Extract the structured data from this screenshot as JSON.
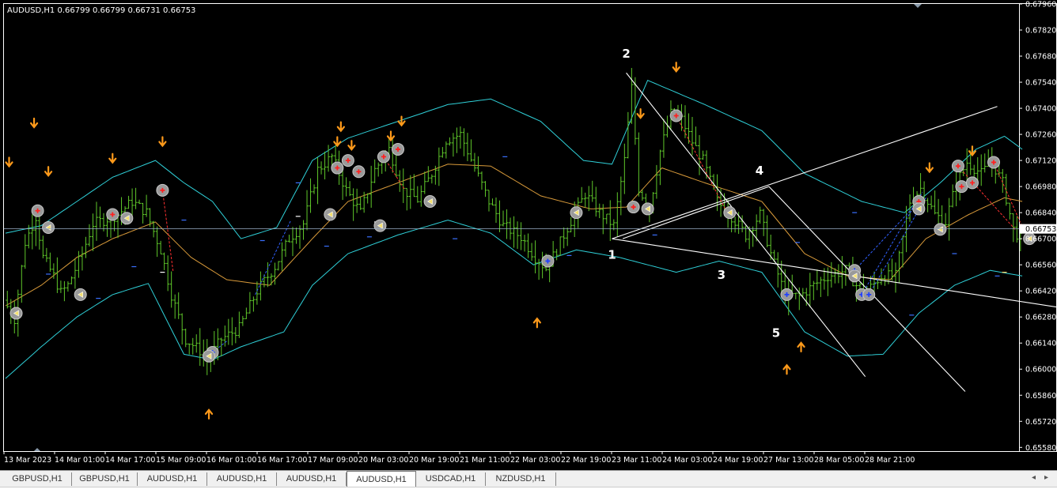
{
  "symbol_header": "AUDUSD,H1  0.66799 0.66799 0.66731 0.66753",
  "current_price_label": "0.66753",
  "colors": {
    "background": "#000000",
    "frame": "#ffffff",
    "bull_bar": "#5fc72a",
    "upper_lower_band": "#2fd0d8",
    "middle_band": "#d89a3a",
    "pattern_lines": "#ffffff",
    "arrow": "#ff9a1a",
    "projection_red": "#ff3030",
    "projection_blue": "#3060ff",
    "current_price_line": "#9ab0c8"
  },
  "wave_labels": [
    "1",
    "2",
    "3",
    "4",
    "5"
  ],
  "tabs": [
    "GBPUSD,H1",
    "GBPUSD,H1",
    "AUDUSD,H1",
    "AUDUSD,H1",
    "AUDUSD,H1",
    "AUDUSD,H1",
    "USDCAD,H1",
    "NZDUSD,H1"
  ],
  "active_tab": 5,
  "tab_scroll_left": "◂",
  "tab_scroll_right": "▸",
  "chart_data": {
    "type": "candlestick",
    "title": "AUDUSD,H1",
    "ylim": [
      0.6556,
      0.6796
    ],
    "y_ticks": [
      "0.67960",
      "0.67820",
      "0.67680",
      "0.67540",
      "0.67400",
      "0.67260",
      "0.67120",
      "0.66980",
      "0.66840",
      "0.66700",
      "0.66560",
      "0.66420",
      "0.66280",
      "0.66140",
      "0.66000",
      "0.65860",
      "0.65720",
      "0.65580"
    ],
    "x_ticks": [
      "13 Mar 2023",
      "14 Mar 01:00",
      "14 Mar 17:00",
      "15 Mar 09:00",
      "16 Mar 01:00",
      "16 Mar 17:00",
      "17 Mar 09:00",
      "20 Mar 03:00",
      "20 Mar 19:00",
      "21 Mar 11:00",
      "22 Mar 03:00",
      "22 Mar 19:00",
      "23 Mar 11:00",
      "24 Mar 03:00",
      "24 Mar 19:00",
      "27 Mar 13:00",
      "28 Mar 05:00",
      "28 Mar 21:00"
    ],
    "bars_count": 285,
    "current_price": 0.66753,
    "price_path": [
      [
        0,
        0.6637
      ],
      [
        3,
        0.6627
      ],
      [
        6,
        0.6668
      ],
      [
        9,
        0.6682
      ],
      [
        11,
        0.666
      ],
      [
        14,
        0.665
      ],
      [
        16,
        0.6641
      ],
      [
        18,
        0.6645
      ],
      [
        22,
        0.6662
      ],
      [
        25,
        0.6678
      ],
      [
        28,
        0.668
      ],
      [
        32,
        0.6683
      ],
      [
        36,
        0.669
      ],
      [
        40,
        0.6684
      ],
      [
        44,
        0.6664
      ],
      [
        47,
        0.664
      ],
      [
        51,
        0.6616
      ],
      [
        55,
        0.661
      ],
      [
        57,
        0.6605
      ],
      [
        61,
        0.6616
      ],
      [
        66,
        0.6622
      ],
      [
        71,
        0.6642
      ],
      [
        76,
        0.6655
      ],
      [
        80,
        0.667
      ],
      [
        84,
        0.6678
      ],
      [
        88,
        0.6707
      ],
      [
        92,
        0.6714
      ],
      [
        96,
        0.6696
      ],
      [
        100,
        0.6684
      ],
      [
        104,
        0.6707
      ],
      [
        108,
        0.6718
      ],
      [
        112,
        0.6696
      ],
      [
        116,
        0.6691
      ],
      [
        120,
        0.6705
      ],
      [
        124,
        0.6723
      ],
      [
        128,
        0.6726
      ],
      [
        132,
        0.6708
      ],
      [
        136,
        0.669
      ],
      [
        140,
        0.6677
      ],
      [
        145,
        0.6671
      ],
      [
        149,
        0.666
      ],
      [
        152,
        0.6654
      ],
      [
        155,
        0.6664
      ],
      [
        158,
        0.6676
      ],
      [
        163,
        0.6694
      ],
      [
        167,
        0.6684
      ],
      [
        171,
        0.6677
      ],
      [
        174,
        0.6712
      ],
      [
        176,
        0.6751
      ],
      [
        178,
        0.6697
      ],
      [
        181,
        0.6686
      ],
      [
        184,
        0.6717
      ],
      [
        187,
        0.6737
      ],
      [
        190,
        0.6734
      ],
      [
        193,
        0.6722
      ],
      [
        196,
        0.6712
      ],
      [
        200,
        0.669
      ],
      [
        204,
        0.6682
      ],
      [
        208,
        0.6672
      ],
      [
        212,
        0.6683
      ],
      [
        215,
        0.6662
      ],
      [
        219,
        0.664
      ],
      [
        223,
        0.6639
      ],
      [
        227,
        0.6645
      ],
      [
        231,
        0.665
      ],
      [
        236,
        0.6653
      ],
      [
        239,
        0.6645
      ],
      [
        242,
        0.6642
      ],
      [
        246,
        0.665
      ],
      [
        250,
        0.665
      ],
      [
        254,
        0.669
      ],
      [
        257,
        0.6697
      ],
      [
        261,
        0.6683
      ],
      [
        264,
        0.6679
      ],
      [
        267,
        0.67
      ],
      [
        270,
        0.6711
      ],
      [
        274,
        0.6705
      ],
      [
        277,
        0.6711
      ],
      [
        280,
        0.67
      ],
      [
        283,
        0.6675
      ],
      [
        285,
        0.667
      ]
    ],
    "upper_band": [
      [
        0,
        0.6673
      ],
      [
        10,
        0.6677
      ],
      [
        20,
        0.669
      ],
      [
        30,
        0.6703
      ],
      [
        42,
        0.6712
      ],
      [
        50,
        0.67
      ],
      [
        58,
        0.669
      ],
      [
        66,
        0.667
      ],
      [
        76,
        0.6676
      ],
      [
        86,
        0.6712
      ],
      [
        96,
        0.6724
      ],
      [
        110,
        0.6733
      ],
      [
        124,
        0.6742
      ],
      [
        136,
        0.6745
      ],
      [
        150,
        0.6733
      ],
      [
        162,
        0.6712
      ],
      [
        170,
        0.671
      ],
      [
        180,
        0.6755
      ],
      [
        196,
        0.6742
      ],
      [
        212,
        0.6728
      ],
      [
        224,
        0.6705
      ],
      [
        240,
        0.669
      ],
      [
        252,
        0.6684
      ],
      [
        262,
        0.67
      ],
      [
        272,
        0.6718
      ],
      [
        280,
        0.6725
      ],
      [
        285,
        0.6718
      ]
    ],
    "lower_band": [
      [
        0,
        0.6595
      ],
      [
        10,
        0.6612
      ],
      [
        20,
        0.6628
      ],
      [
        30,
        0.664
      ],
      [
        40,
        0.6646
      ],
      [
        50,
        0.6608
      ],
      [
        58,
        0.6605
      ],
      [
        66,
        0.6612
      ],
      [
        78,
        0.662
      ],
      [
        86,
        0.6645
      ],
      [
        96,
        0.6662
      ],
      [
        110,
        0.6672
      ],
      [
        124,
        0.668
      ],
      [
        136,
        0.6673
      ],
      [
        148,
        0.6656
      ],
      [
        160,
        0.6664
      ],
      [
        172,
        0.666
      ],
      [
        188,
        0.6652
      ],
      [
        200,
        0.6658
      ],
      [
        212,
        0.6652
      ],
      [
        224,
        0.662
      ],
      [
        236,
        0.6607
      ],
      [
        246,
        0.6608
      ],
      [
        256,
        0.663
      ],
      [
        266,
        0.6645
      ],
      [
        276,
        0.6653
      ],
      [
        285,
        0.665
      ]
    ],
    "middle_band": [
      [
        0,
        0.6634
      ],
      [
        10,
        0.6645
      ],
      [
        20,
        0.666
      ],
      [
        30,
        0.667
      ],
      [
        42,
        0.6679
      ],
      [
        52,
        0.666
      ],
      [
        62,
        0.6648
      ],
      [
        74,
        0.6645
      ],
      [
        86,
        0.667
      ],
      [
        96,
        0.669
      ],
      [
        110,
        0.67
      ],
      [
        124,
        0.671
      ],
      [
        136,
        0.6709
      ],
      [
        150,
        0.6693
      ],
      [
        164,
        0.6686
      ],
      [
        174,
        0.6687
      ],
      [
        184,
        0.6708
      ],
      [
        196,
        0.67
      ],
      [
        212,
        0.669
      ],
      [
        224,
        0.6662
      ],
      [
        236,
        0.665
      ],
      [
        248,
        0.6648
      ],
      [
        258,
        0.667
      ],
      [
        270,
        0.6683
      ],
      [
        280,
        0.6692
      ],
      [
        285,
        0.669
      ]
    ],
    "pattern_lines": [
      {
        "from": [
          170,
          0.667
        ],
        "to": [
          278,
          0.6741
        ]
      },
      {
        "from": [
          170,
          0.667
        ],
        "to": [
          306,
          0.663
        ]
      },
      {
        "from": [
          174,
          0.6759
        ],
        "to": [
          241,
          0.6596
        ]
      },
      {
        "from": [
          173,
          0.667
        ],
        "to": [
          214,
          0.6698
        ]
      },
      {
        "from": [
          214,
          0.6698
        ],
        "to": [
          269,
          0.6588
        ]
      }
    ],
    "wave_points": [
      [
        170,
        0.6666
      ],
      [
        174,
        0.6763
      ],
      [
        202,
        0.6656
      ],
      [
        210,
        0.6701
      ],
      [
        216,
        0.6625
      ]
    ],
    "down_arrows": [
      [
        1,
        0.6711
      ],
      [
        8,
        0.6732
      ],
      [
        12,
        0.6706
      ],
      [
        30,
        0.6713
      ],
      [
        44,
        0.6722
      ],
      [
        94,
        0.673
      ],
      [
        93,
        0.6722
      ],
      [
        97,
        0.672
      ],
      [
        108,
        0.6725
      ],
      [
        111,
        0.6733
      ],
      [
        178,
        0.6737
      ],
      [
        188,
        0.6762
      ],
      [
        259,
        0.6708
      ],
      [
        271,
        0.6717
      ]
    ],
    "up_arrows": [
      [
        57,
        0.6576
      ],
      [
        149,
        0.6625
      ],
      [
        219,
        0.66
      ],
      [
        223,
        0.6612
      ]
    ],
    "sell_markers": [
      [
        9,
        0.6685
      ],
      [
        30,
        0.6683
      ],
      [
        44,
        0.6696
      ],
      [
        93,
        0.6708
      ],
      [
        96,
        0.6712
      ],
      [
        99,
        0.6706
      ],
      [
        106,
        0.6714
      ],
      [
        110,
        0.6718
      ],
      [
        176,
        0.6687
      ],
      [
        188,
        0.6736
      ],
      [
        256,
        0.669
      ],
      [
        267,
        0.6709
      ],
      [
        268,
        0.6698
      ],
      [
        271,
        0.67
      ],
      [
        277,
        0.6711
      ]
    ],
    "buy_markers": [
      [
        58,
        0.6609
      ],
      [
        152,
        0.6658
      ],
      [
        219,
        0.664
      ],
      [
        238,
        0.6653
      ],
      [
        240,
        0.664
      ],
      [
        242,
        0.664
      ]
    ],
    "exit_markers": [
      [
        3,
        0.663
      ],
      [
        12,
        0.6676
      ],
      [
        21,
        0.664
      ],
      [
        34,
        0.6681
      ],
      [
        57,
        0.6607
      ],
      [
        91,
        0.6683
      ],
      [
        105,
        0.6677
      ],
      [
        119,
        0.669
      ],
      [
        160,
        0.6684
      ],
      [
        180,
        0.6686
      ],
      [
        203,
        0.6684
      ],
      [
        238,
        0.665
      ],
      [
        256,
        0.6686
      ],
      [
        262,
        0.6675
      ],
      [
        287,
        0.667
      ]
    ]
  }
}
